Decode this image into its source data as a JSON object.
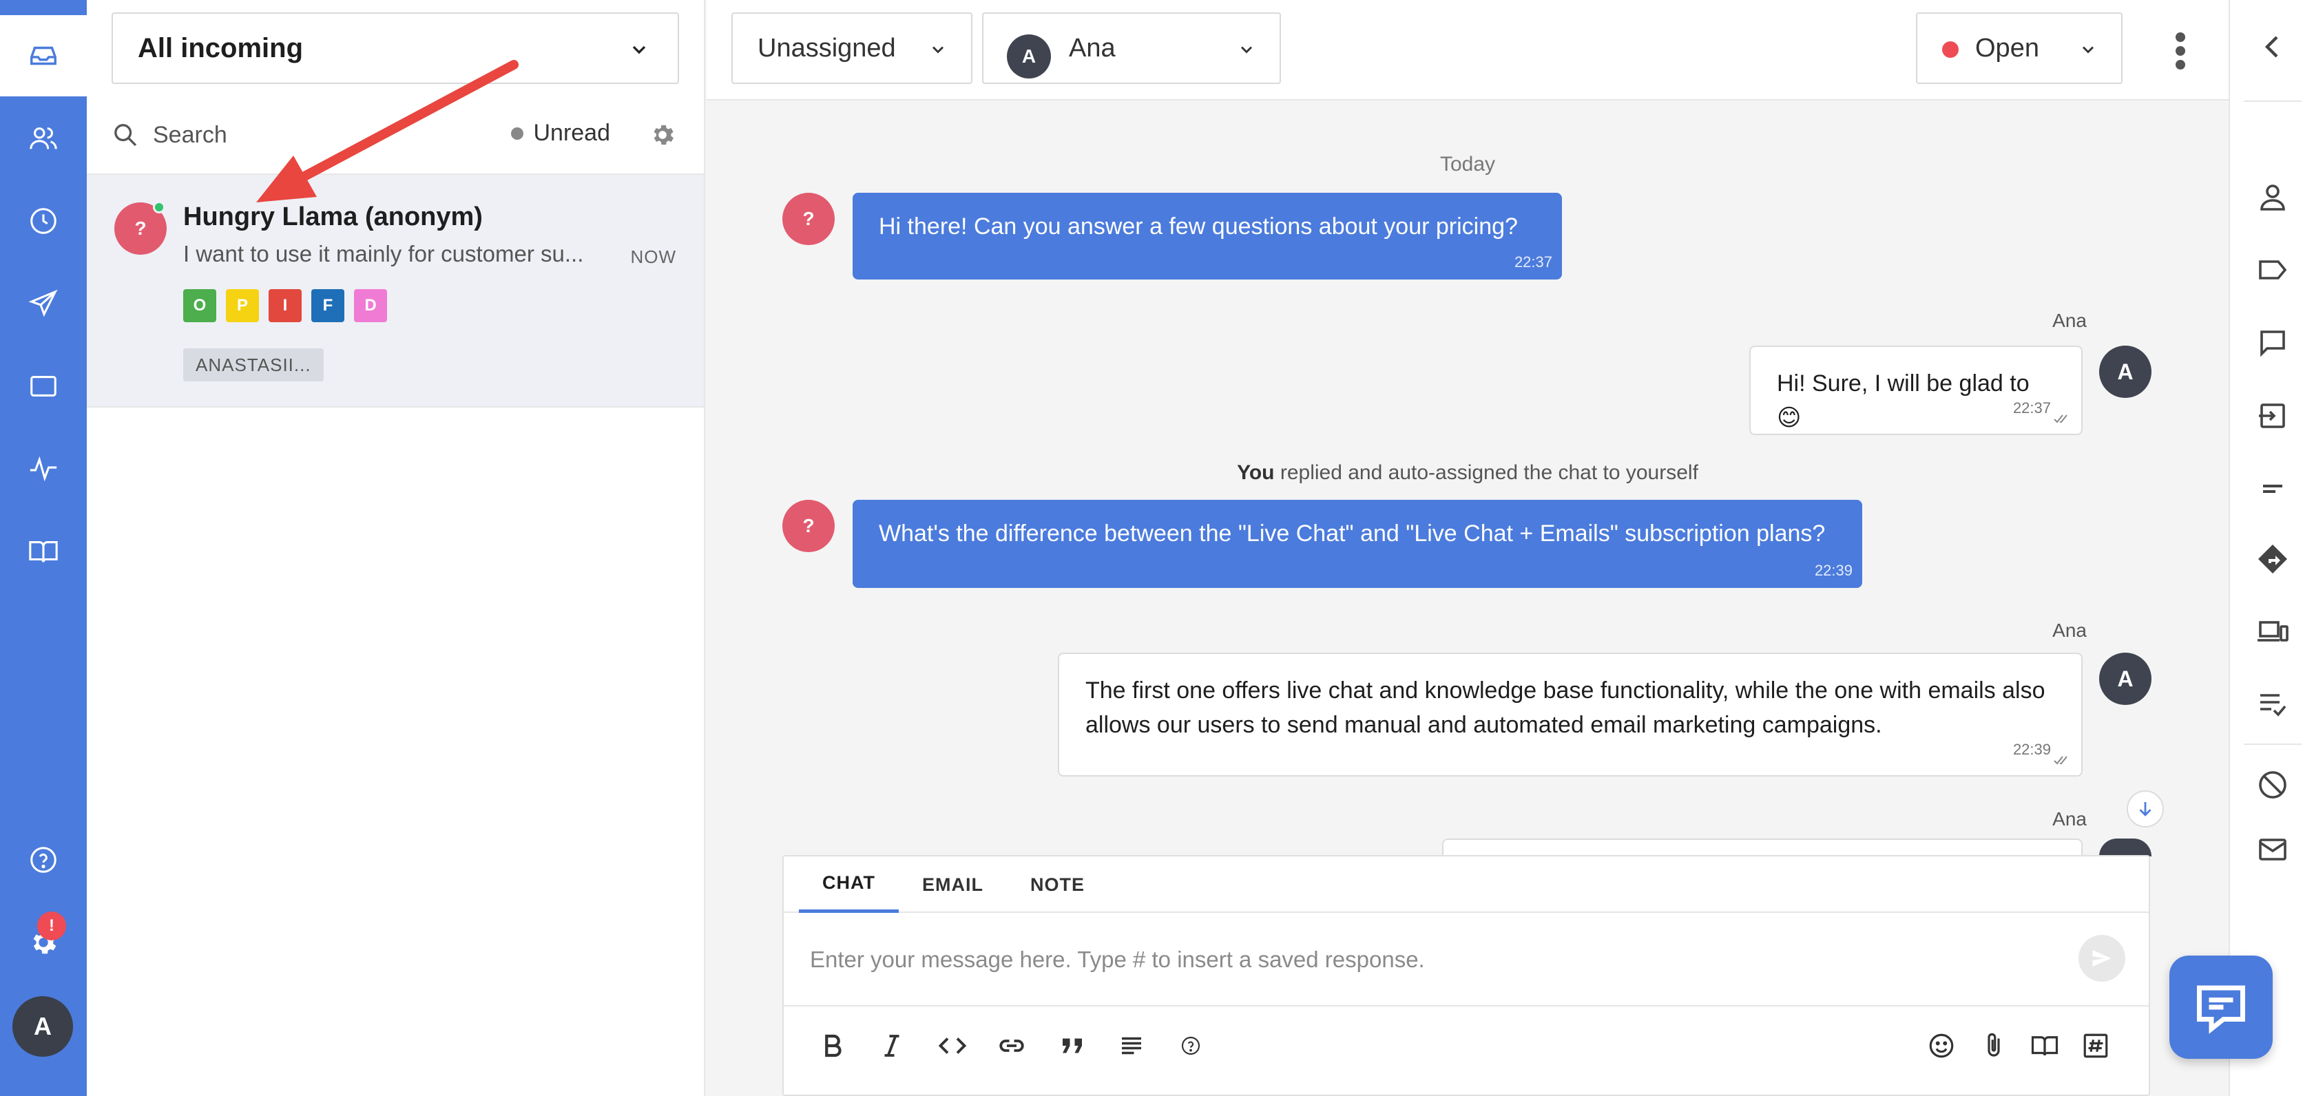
{
  "nav": {
    "items": [
      {
        "icon": "inbox-icon"
      },
      {
        "icon": "contacts-icon"
      },
      {
        "icon": "history-icon"
      },
      {
        "icon": "send-icon"
      },
      {
        "icon": "widget-icon"
      },
      {
        "icon": "activity-icon"
      },
      {
        "icon": "knowledge-book-icon"
      }
    ],
    "help_icon": "help-icon",
    "settings_badge": "!",
    "user_initial": "A",
    "accent": "#4b7bdc"
  },
  "list": {
    "inbox_filter": "All incoming",
    "search_placeholder": "Search",
    "unread_label": "Unread",
    "conversation": {
      "avatar_initial": "?",
      "name": "Hungry Llama (anonym)",
      "preview": "I want to use it mainly for customer su...",
      "time": "NOW",
      "tags": [
        {
          "letter": "O",
          "color": "#4cae4c"
        },
        {
          "letter": "P",
          "color": "#f5d312"
        },
        {
          "letter": "I",
          "color": "#e2483d"
        },
        {
          "letter": "F",
          "color": "#1f6fb8"
        },
        {
          "letter": "D",
          "color": "#f07bd4"
        }
      ],
      "assignee": "ANASTASII..."
    }
  },
  "topbar": {
    "assignment": "Unassigned",
    "agent_initial": "A",
    "agent_name": "Ana",
    "status": "Open",
    "status_color": "#ef4b55"
  },
  "chat": {
    "day_label": "Today",
    "messages": [
      {
        "text": "Hi there! Can you answer a few questions about your pricing?",
        "time": "22:37"
      },
      {
        "sender": "Ana",
        "text": "Hi! Sure, I will be glad to 😊",
        "time": "22:37"
      },
      {
        "text": "What's the difference between the \"Live Chat\" and \"Live Chat + Emails\" subscription plans?",
        "time": "22:39"
      },
      {
        "sender": "Ana",
        "text": "The first one offers live chat and knowledge base functionality, while the one with emails also allows our users to send manual and automated email marketing campaigns.",
        "time": "22:39"
      },
      {
        "sender": "Ana"
      }
    ],
    "system": {
      "bold": "You",
      "rest": " replied and auto-assigned the chat to yourself"
    },
    "visitor_initial": "?",
    "agent_initial": "A"
  },
  "composer": {
    "tabs": [
      "CHAT",
      "EMAIL",
      "NOTE"
    ],
    "active_tab": "CHAT",
    "placeholder": "Enter your message here. Type # to insert a saved response."
  }
}
